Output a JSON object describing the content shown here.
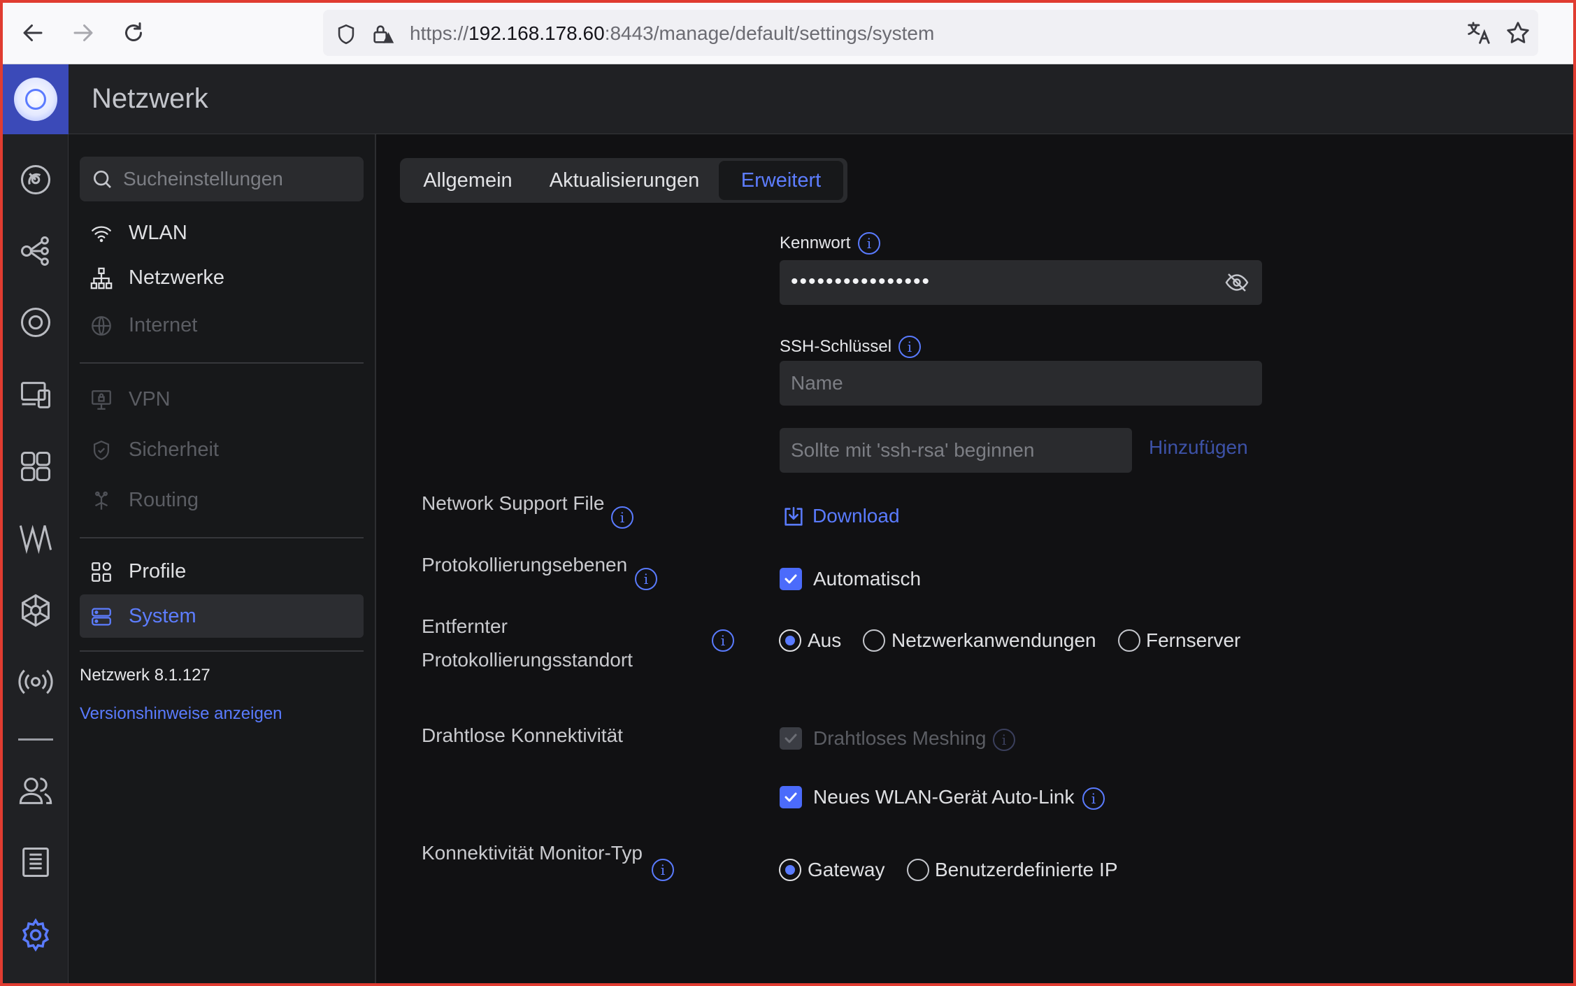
{
  "browser": {
    "url_prefix": "https://",
    "url_host": "192.168.178.60",
    "url_rest": ":8443/manage/default/settings/system"
  },
  "app": {
    "title": "Netzwerk"
  },
  "sidebar": {
    "search_placeholder": "Sucheinstellungen",
    "items": [
      {
        "label": "WLAN",
        "state": "normal"
      },
      {
        "label": "Netzwerke",
        "state": "normal"
      },
      {
        "label": "Internet",
        "state": "disabled"
      },
      {
        "label": "VPN",
        "state": "disabled"
      },
      {
        "label": "Sicherheit",
        "state": "disabled"
      },
      {
        "label": "Routing",
        "state": "disabled"
      },
      {
        "label": "Profile",
        "state": "normal"
      },
      {
        "label": "System",
        "state": "active"
      }
    ],
    "version": "Netzwerk 8.1.127",
    "release_notes_link": "Versionshinweise anzeigen"
  },
  "tabs": [
    {
      "label": "Allgemein",
      "active": false
    },
    {
      "label": "Aktualisierungen",
      "active": false
    },
    {
      "label": "Erweitert",
      "active": true
    }
  ],
  "form": {
    "password_label": "Kennwort",
    "password_mask": "••••••••••••••••",
    "ssh_label": "SSH-Schlüssel",
    "ssh_name_placeholder": "Name",
    "ssh_key_placeholder": "Sollte mit 'ssh-rsa' beginnen",
    "ssh_add": "Hinzufügen",
    "support_file_label": "Network Support File",
    "download": "Download",
    "log_levels_label": "Protokollierungsebenen",
    "auto": "Automatisch",
    "remote_log_label_1": "Entfernter",
    "remote_log_label_2": "Protokollierungsstandort",
    "remote_options": [
      "Aus",
      "Netzwerkanwendungen",
      "Fernserver"
    ],
    "remote_selected": "Aus",
    "wireless_label": "Drahtlose Konnektivität",
    "wireless_meshing": "Drahtloses Meshing",
    "auto_link": "Neues WLAN-Gerät Auto-Link",
    "monitor_label": "Konnektivität Monitor-Typ",
    "monitor_options": [
      "Gateway",
      "Benutzerdefinierte IP"
    ],
    "monitor_selected": "Gateway"
  },
  "colors": {
    "accent": "#4b6bfb",
    "link": "#5a7bff",
    "background": "#111113",
    "panel": "#202124"
  }
}
